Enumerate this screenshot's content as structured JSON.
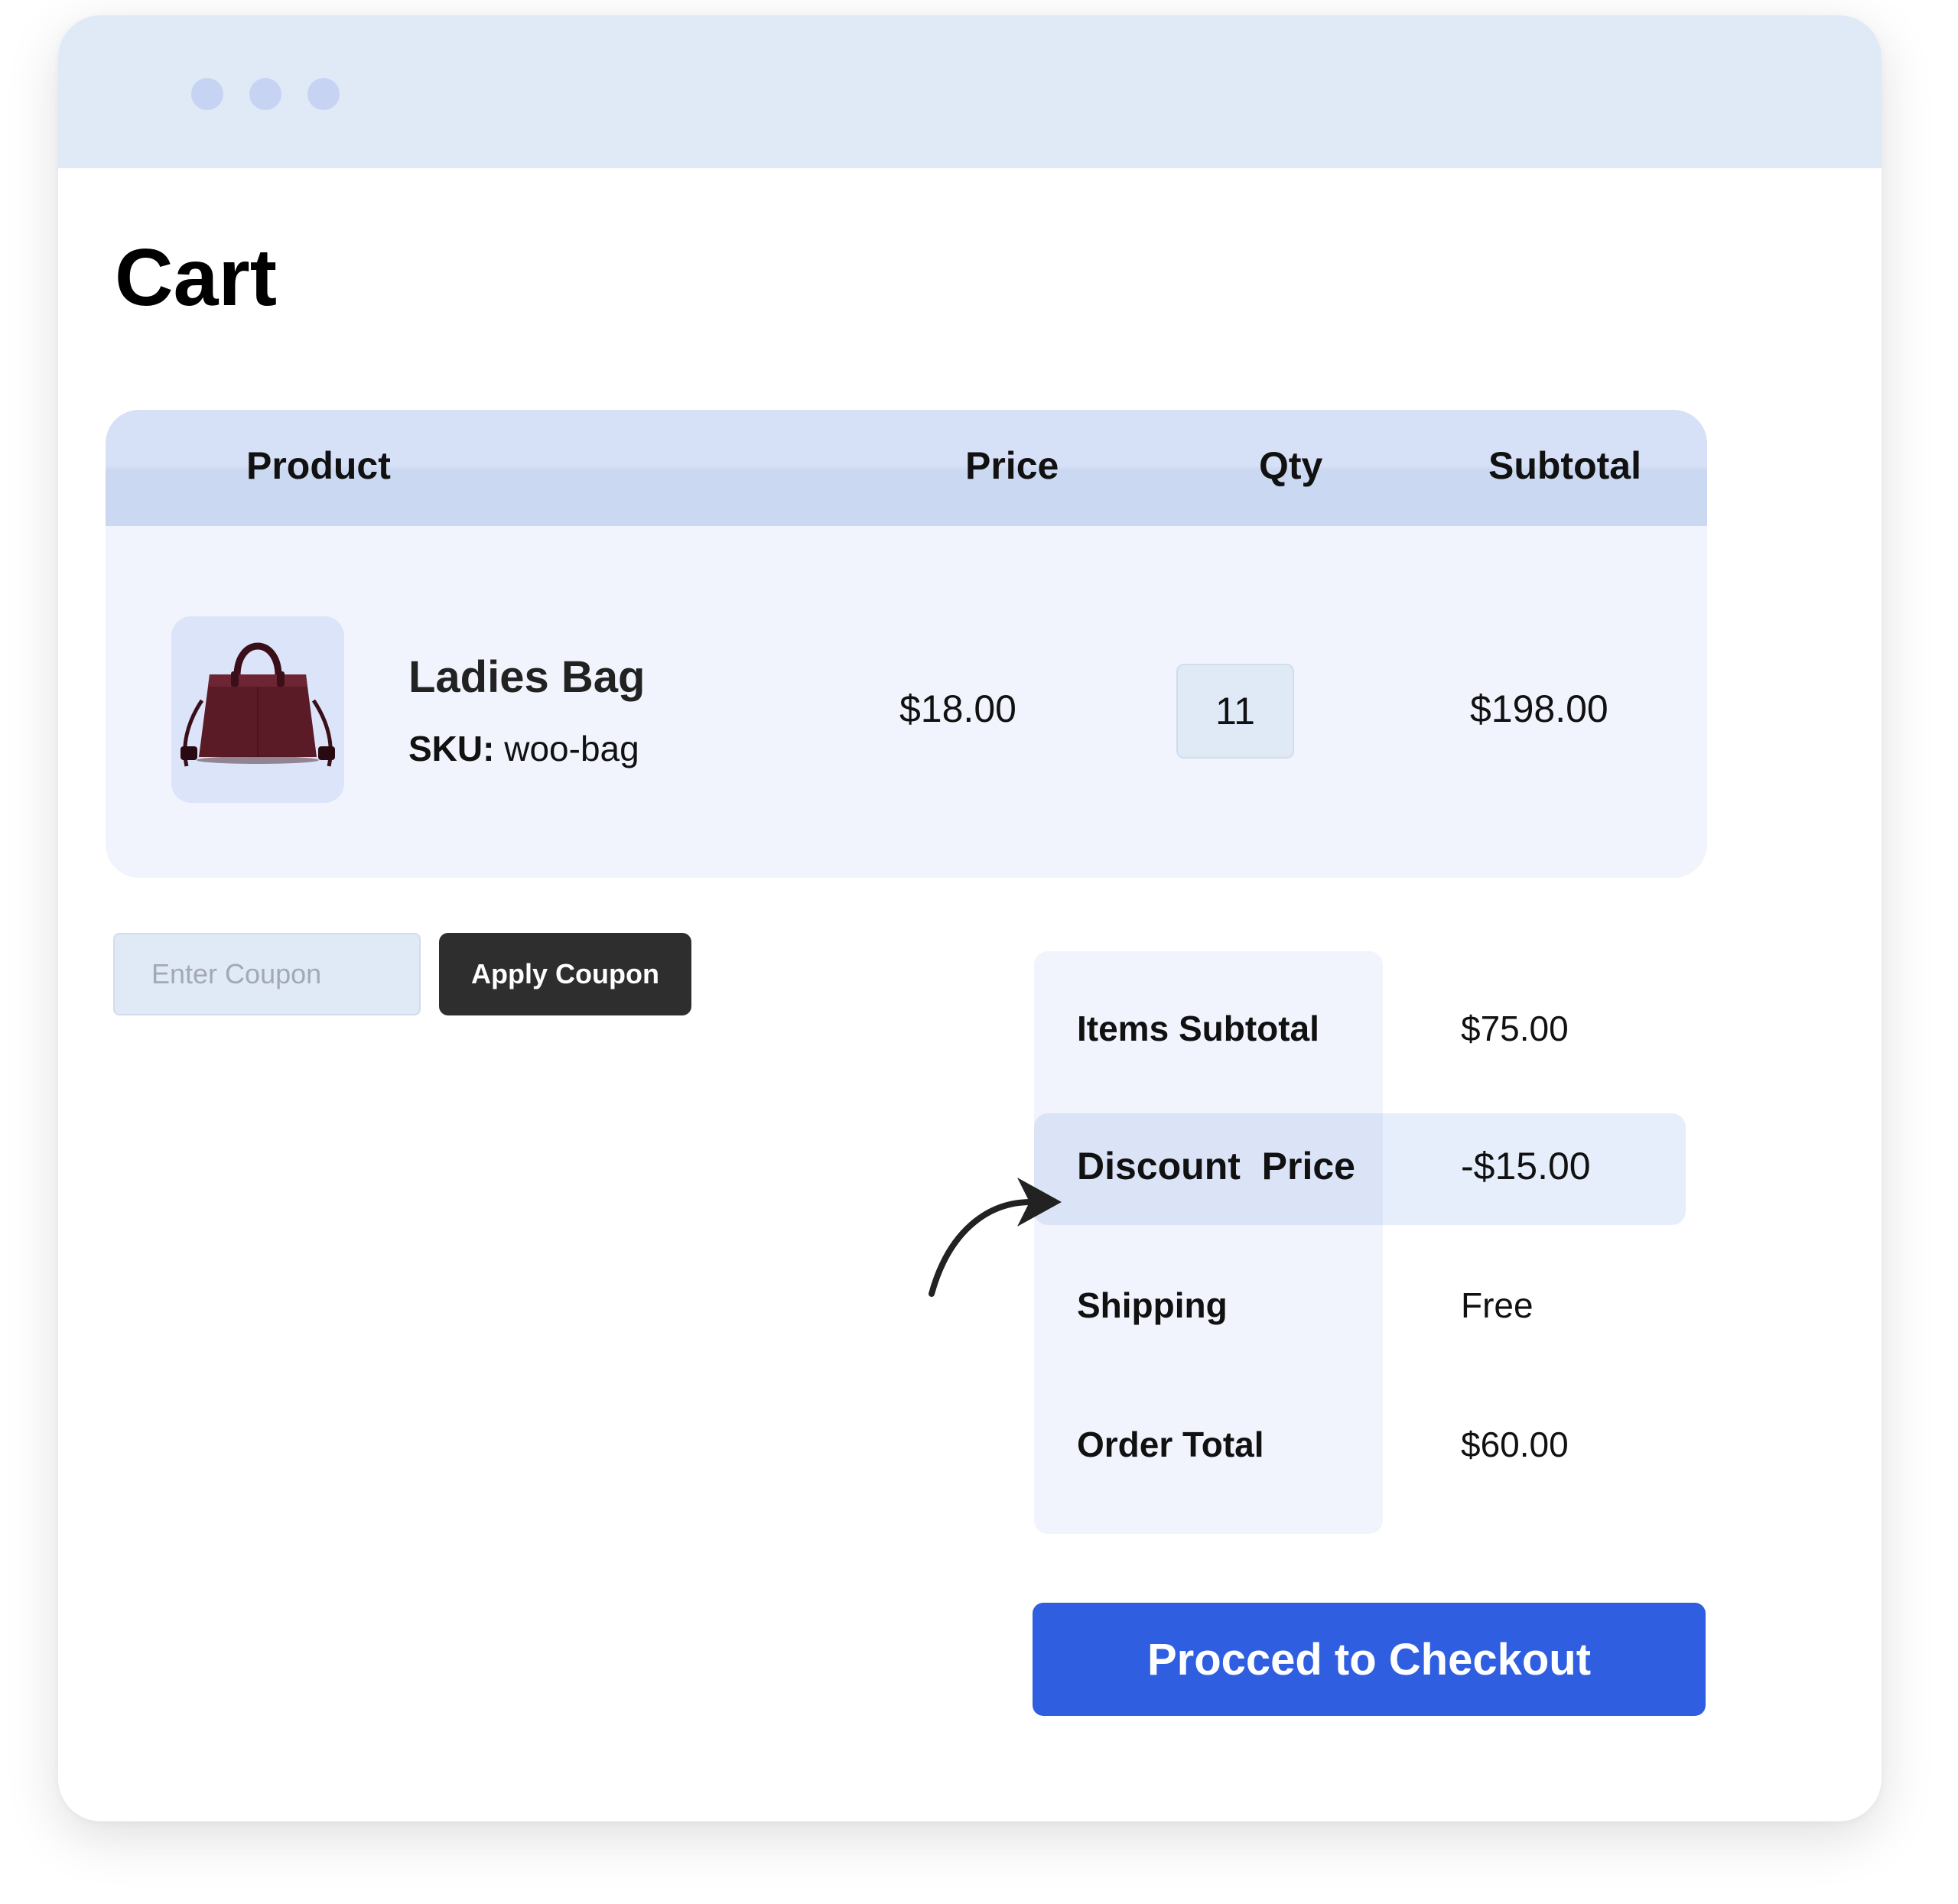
{
  "window": {
    "controls": [
      "window-dot",
      "window-dot",
      "window-dot"
    ]
  },
  "page": {
    "title": "Cart"
  },
  "cart": {
    "columns": {
      "product": "Product",
      "price": "Price",
      "qty": "Qty",
      "subtotal": "Subtotal"
    },
    "items": [
      {
        "image_icon": "handbag-icon",
        "name": "Ladies Bag",
        "sku_label": "SKU:",
        "sku": "woo-bag",
        "price": "$18.00",
        "qty": "11",
        "subtotal": "$198.00"
      }
    ]
  },
  "coupon": {
    "placeholder": "Enter Coupon",
    "apply_label": "Apply Coupon"
  },
  "totals": {
    "items_subtotal_label": "Items Subtotal",
    "items_subtotal_value": "$75.00",
    "discount_label": "Discount  Price",
    "discount_value": "-$15.00",
    "shipping_label": "Shipping",
    "shipping_value": "Free",
    "order_total_label": "Order Total",
    "order_total_value": "$60.00"
  },
  "checkout": {
    "label": "Procced to Checkout"
  },
  "annotation": {
    "icon": "curved-arrow-icon"
  },
  "colors": {
    "titlebar": "#e0e9f6",
    "window_dot": "#c6d3f3",
    "table_header": "#d6e0f7",
    "table_body": "#f1f4fc",
    "apply_button": "#2e2e2e",
    "checkout_button": "#2f5fe0",
    "bag": "#5a1a26"
  }
}
